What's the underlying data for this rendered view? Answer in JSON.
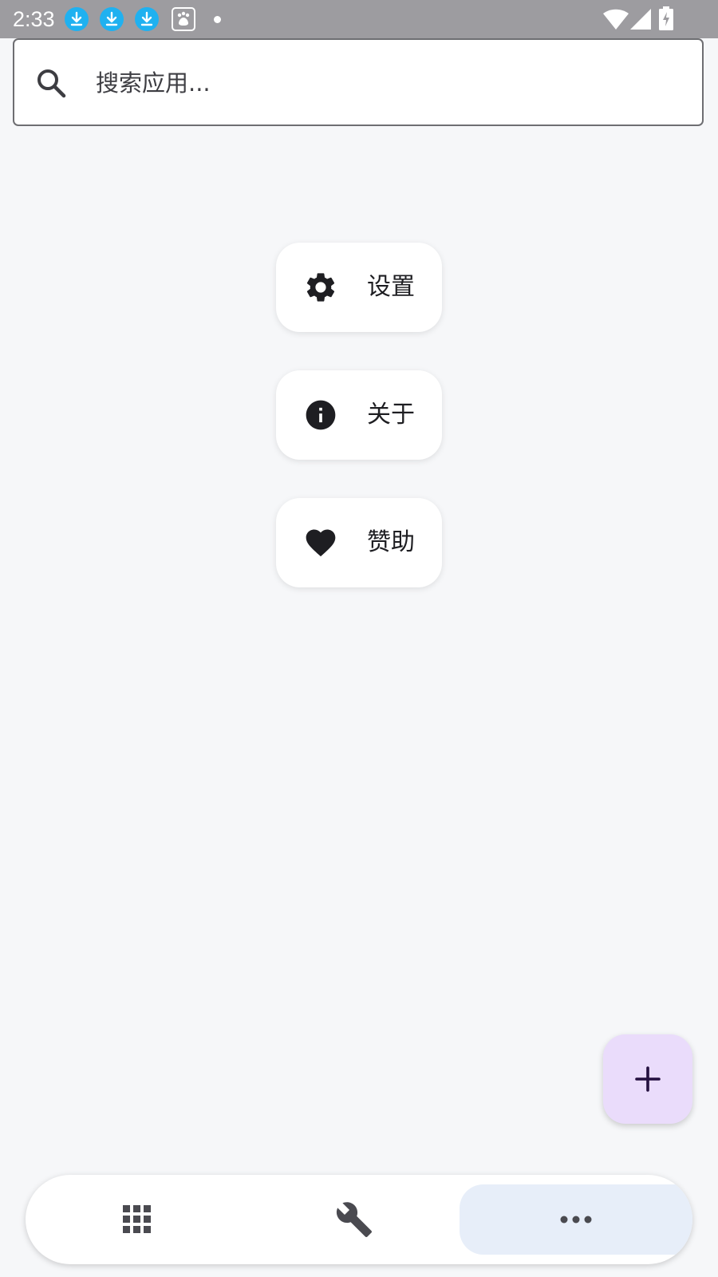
{
  "status_bar": {
    "time": "2:33",
    "icons": [
      "download-icon",
      "download-icon",
      "download-icon",
      "baidu-icon",
      "dot-icon",
      "wifi-icon",
      "signal-icon",
      "battery-charging-icon"
    ]
  },
  "search": {
    "placeholder": "搜索应用..."
  },
  "menu": {
    "items": [
      {
        "label": "设置",
        "icon": "gear-icon"
      },
      {
        "label": "关于",
        "icon": "info-icon"
      },
      {
        "label": "赞助",
        "icon": "heart-icon"
      }
    ]
  },
  "fab": {
    "icon": "plus-icon"
  },
  "bottom_nav": {
    "items": [
      {
        "icon": "apps-grid-icon",
        "selected": false
      },
      {
        "icon": "wrench-icon",
        "selected": false
      },
      {
        "icon": "more-horizontal-icon",
        "selected": true
      }
    ]
  },
  "colors": {
    "status_bar_bg": "#9d9ca0",
    "page_bg": "#f6f7f9",
    "fab_bg": "#eadcfb",
    "nav_selected_bg": "#e7eef9",
    "download_blue": "#1fb1f0"
  }
}
